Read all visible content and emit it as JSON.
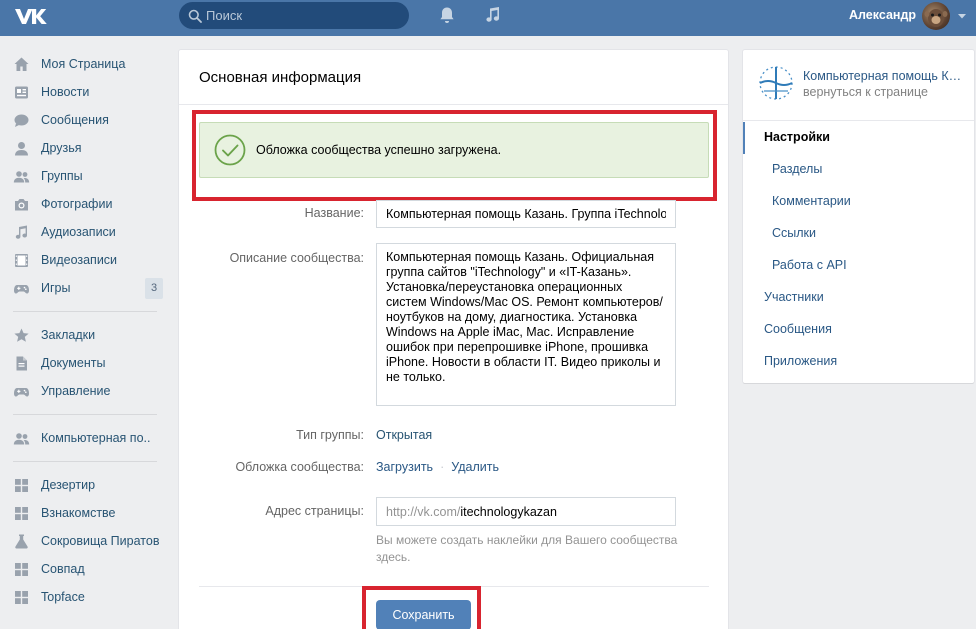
{
  "header": {
    "search_placeholder": "Поиск",
    "user_name": "Александр"
  },
  "left_nav": {
    "items": [
      {
        "label": "Моя Страница"
      },
      {
        "label": "Новости"
      },
      {
        "label": "Сообщения"
      },
      {
        "label": "Друзья"
      },
      {
        "label": "Группы"
      },
      {
        "label": "Фотографии"
      },
      {
        "label": "Аудиозаписи"
      },
      {
        "label": "Видеозаписи"
      },
      {
        "label": "Игры",
        "badge": "3"
      },
      {
        "label": "Закладки"
      },
      {
        "label": "Документы"
      },
      {
        "label": "Управление"
      },
      {
        "label": "Компьютерная по.."
      },
      {
        "label": "Дезертир"
      },
      {
        "label": "Взнакомстве"
      },
      {
        "label": "Сокровища Пиратов"
      },
      {
        "label": "Совпад"
      },
      {
        "label": "Topface"
      }
    ]
  },
  "main": {
    "title": "Основная информация",
    "success_message": "Обложка сообщества успешно загружена.",
    "name_label": "Название:",
    "name_value": "Компьютерная помощь Казань. Группа iTechnology",
    "description_label": "Описание сообщества:",
    "description_value": "Компьютерная помощь Казань. Официальная группа сайтов \"iTechnology\" и «IT-Казань».  Установка/переустановка операционных систем Windows/Mac OS. Ремонт компьютеров/ноутбуков на дому, диагностика. Установка Windows на Apple iMac, Mac. Исправление ошибок при перепрошивке iPhone, прошивка iPhone. Новости в области IT. Видео приколы и не только.",
    "type_label": "Тип группы:",
    "type_value": "Открытая",
    "cover_label": "Обложка сообщества:",
    "cover_upload": "Загрузить",
    "cover_delete": "Удалить",
    "address_label": "Адрес страницы:",
    "address_prefix": "http://vk.com/",
    "address_value": "itechnologykazan",
    "address_hint": "Вы можете создать наклейки для Вашего сообщества здесь.",
    "save_label": "Сохранить"
  },
  "right_panel": {
    "community_name": "Компьютерная помощь Казань",
    "back_label": "вернуться к странице",
    "menu": [
      {
        "label": "Настройки",
        "active": true
      },
      {
        "label": "Разделы"
      },
      {
        "label": "Комментарии"
      },
      {
        "label": "Ссылки"
      },
      {
        "label": "Работа с API"
      },
      {
        "label": "Участники"
      },
      {
        "label": "Сообщения"
      },
      {
        "label": "Приложения"
      }
    ]
  },
  "colors": {
    "header_bg": "#4a76a8",
    "accent": "#5181b8",
    "link": "#2a5885",
    "success_bg": "#e8f2e0",
    "highlight": "#d8242f"
  }
}
